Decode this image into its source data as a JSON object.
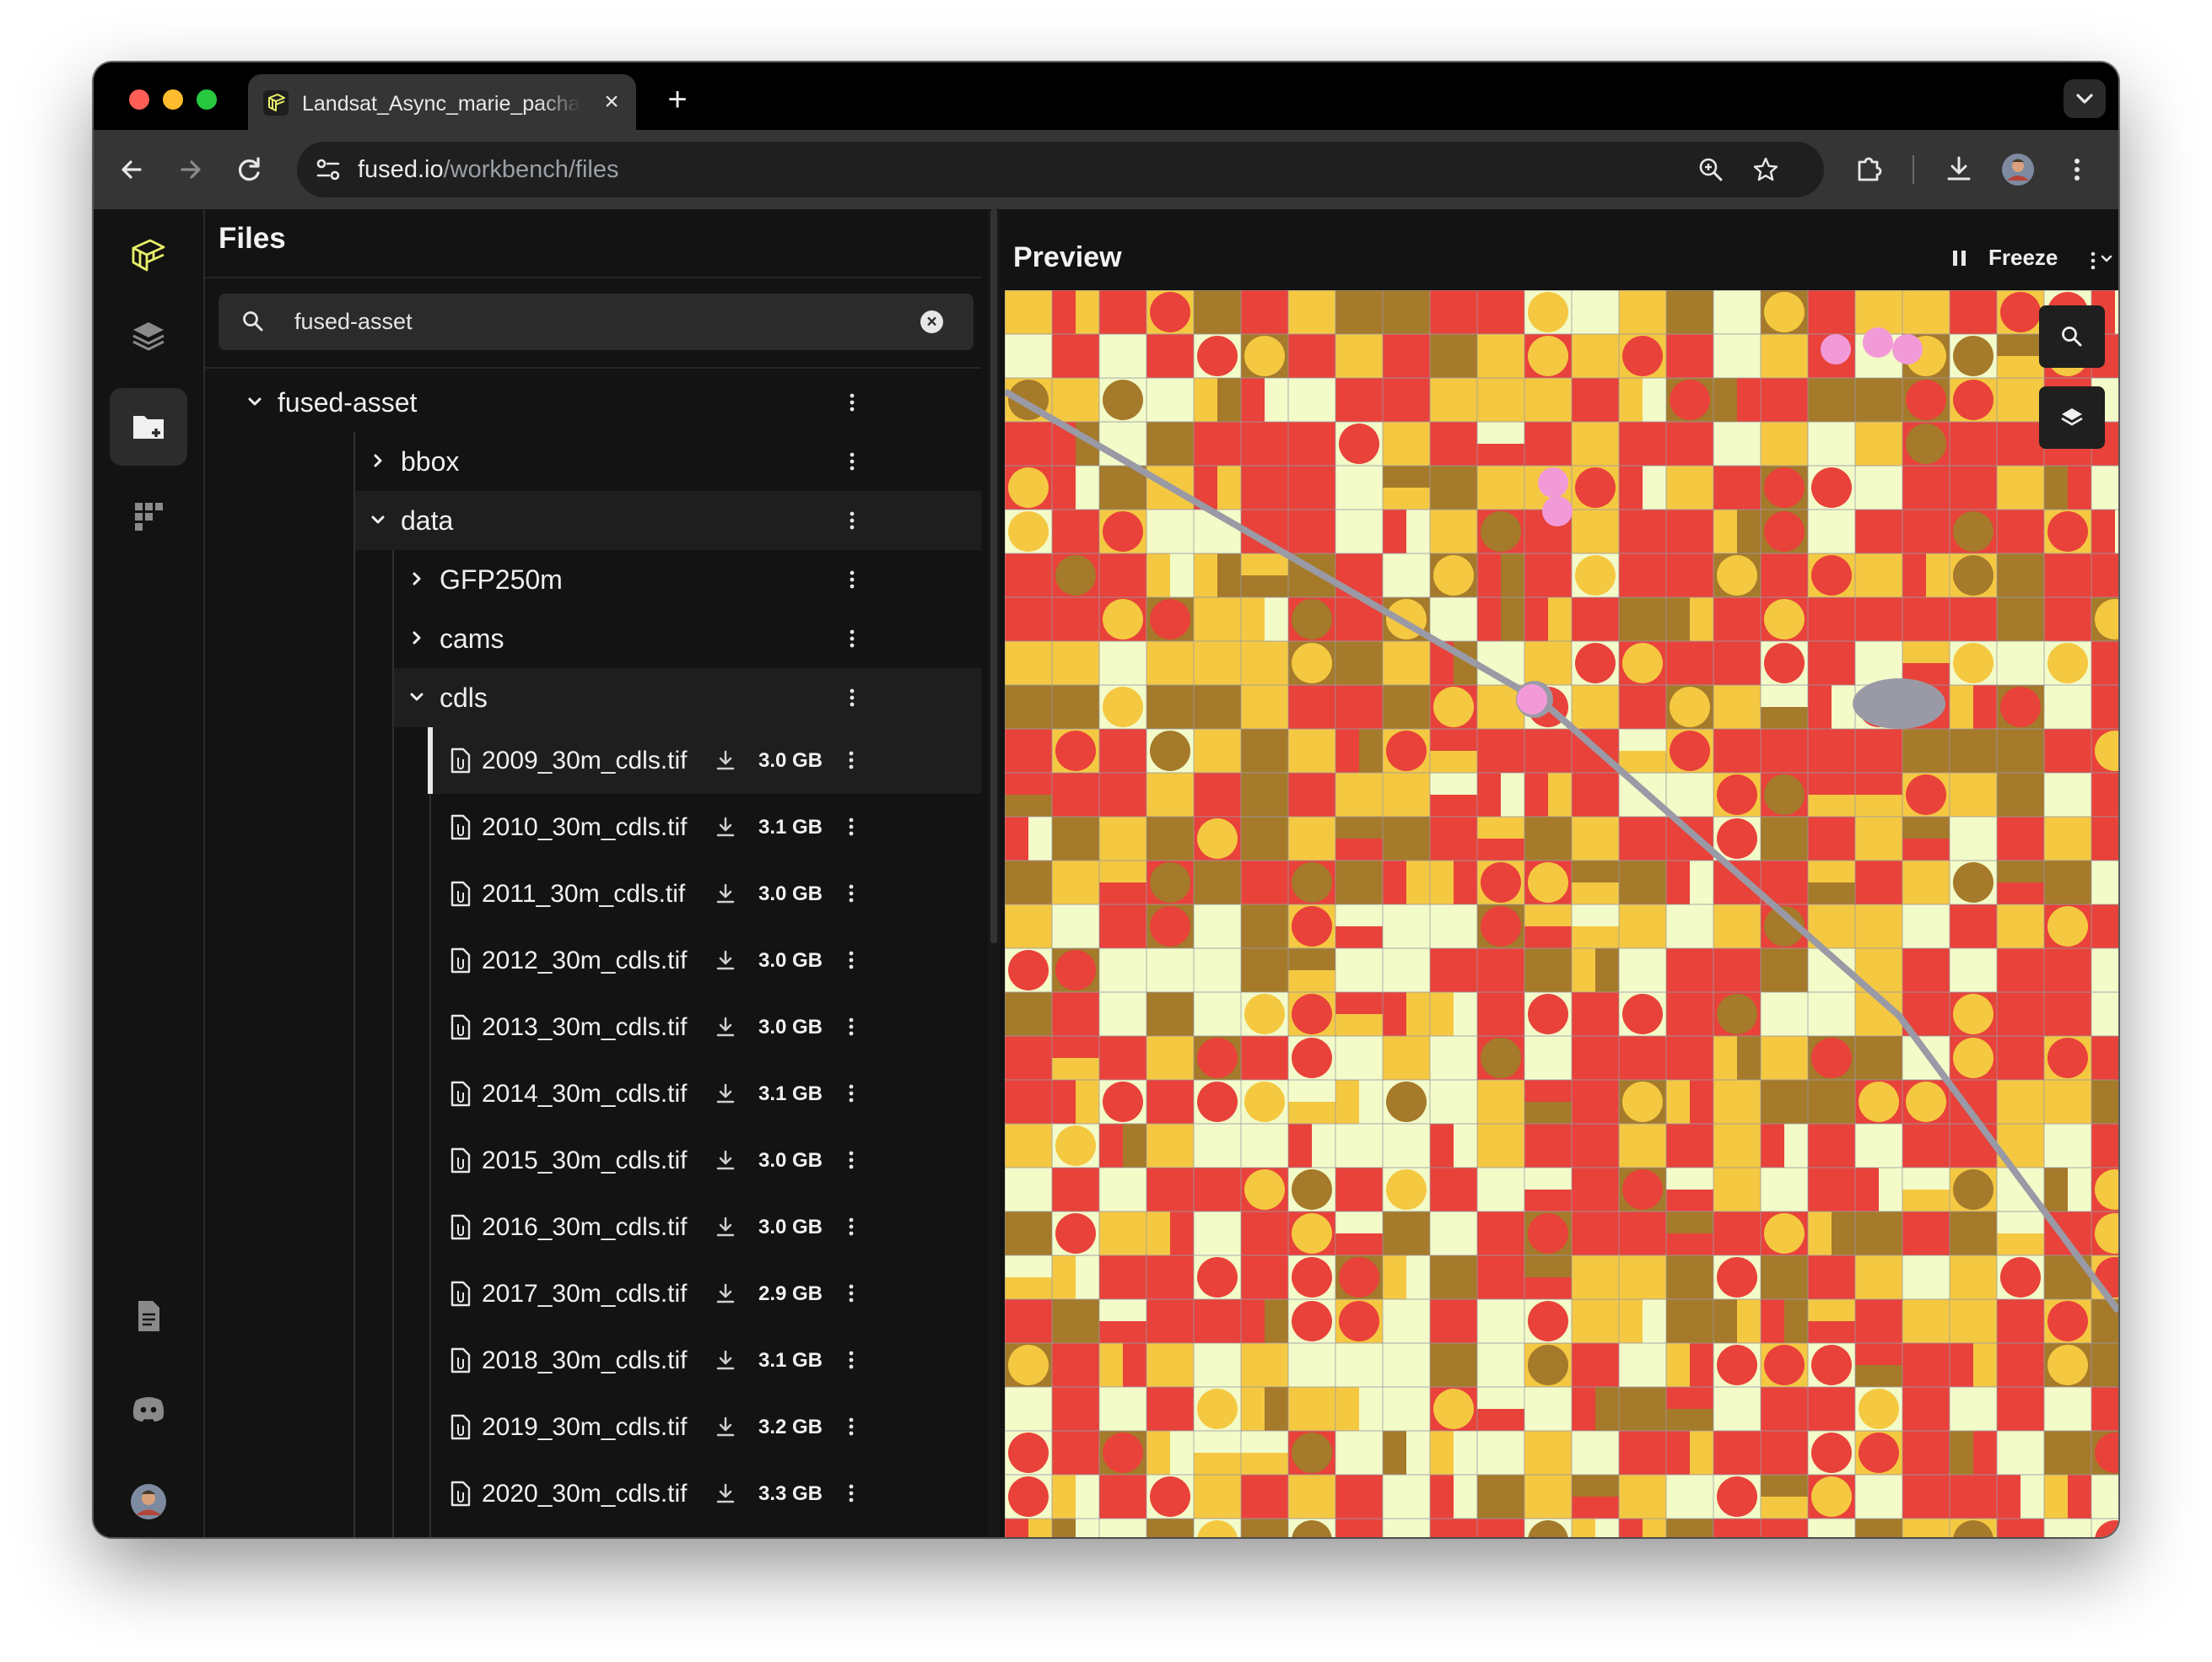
{
  "browser": {
    "tab_title": "Landsat_Async_marie_pachalska",
    "tab_close_icon": "×",
    "new_tab_icon": "+",
    "url_host": "fused.io",
    "url_path": "/workbench/files"
  },
  "files_panel": {
    "title": "Files",
    "search_value": "fused-asset",
    "search_clear_icon": "×",
    "tree": {
      "root_label": "fused-asset",
      "bbox_label": "bbox",
      "data_label": "data",
      "gfp_label": "GFP250m",
      "cams_label": "cams",
      "cdls_label": "cdls"
    },
    "files": [
      {
        "name": "2009_30m_cdls.tif",
        "size": "3.0 GB"
      },
      {
        "name": "2010_30m_cdls.tif",
        "size": "3.1 GB"
      },
      {
        "name": "2011_30m_cdls.tif",
        "size": "3.0 GB"
      },
      {
        "name": "2012_30m_cdls.tif",
        "size": "3.0 GB"
      },
      {
        "name": "2013_30m_cdls.tif",
        "size": "3.0 GB"
      },
      {
        "name": "2014_30m_cdls.tif",
        "size": "3.1 GB"
      },
      {
        "name": "2015_30m_cdls.tif",
        "size": "3.0 GB"
      },
      {
        "name": "2016_30m_cdls.tif",
        "size": "3.0 GB"
      },
      {
        "name": "2017_30m_cdls.tif",
        "size": "2.9 GB"
      },
      {
        "name": "2018_30m_cdls.tif",
        "size": "3.1 GB"
      },
      {
        "name": "2019_30m_cdls.tif",
        "size": "3.2 GB"
      },
      {
        "name": "2020_30m_cdls.tif",
        "size": "3.3 GB"
      }
    ]
  },
  "preview": {
    "title": "Preview",
    "freeze_label": "Freeze"
  },
  "colors": {
    "accent_logo": "#e8f06a",
    "map_red": "#e8423a",
    "map_yellow": "#f5c842",
    "map_brown": "#a57a2a",
    "map_pale": "#f3fbc9",
    "map_road": "#9a9aa6",
    "map_pink": "#f29ad8"
  }
}
